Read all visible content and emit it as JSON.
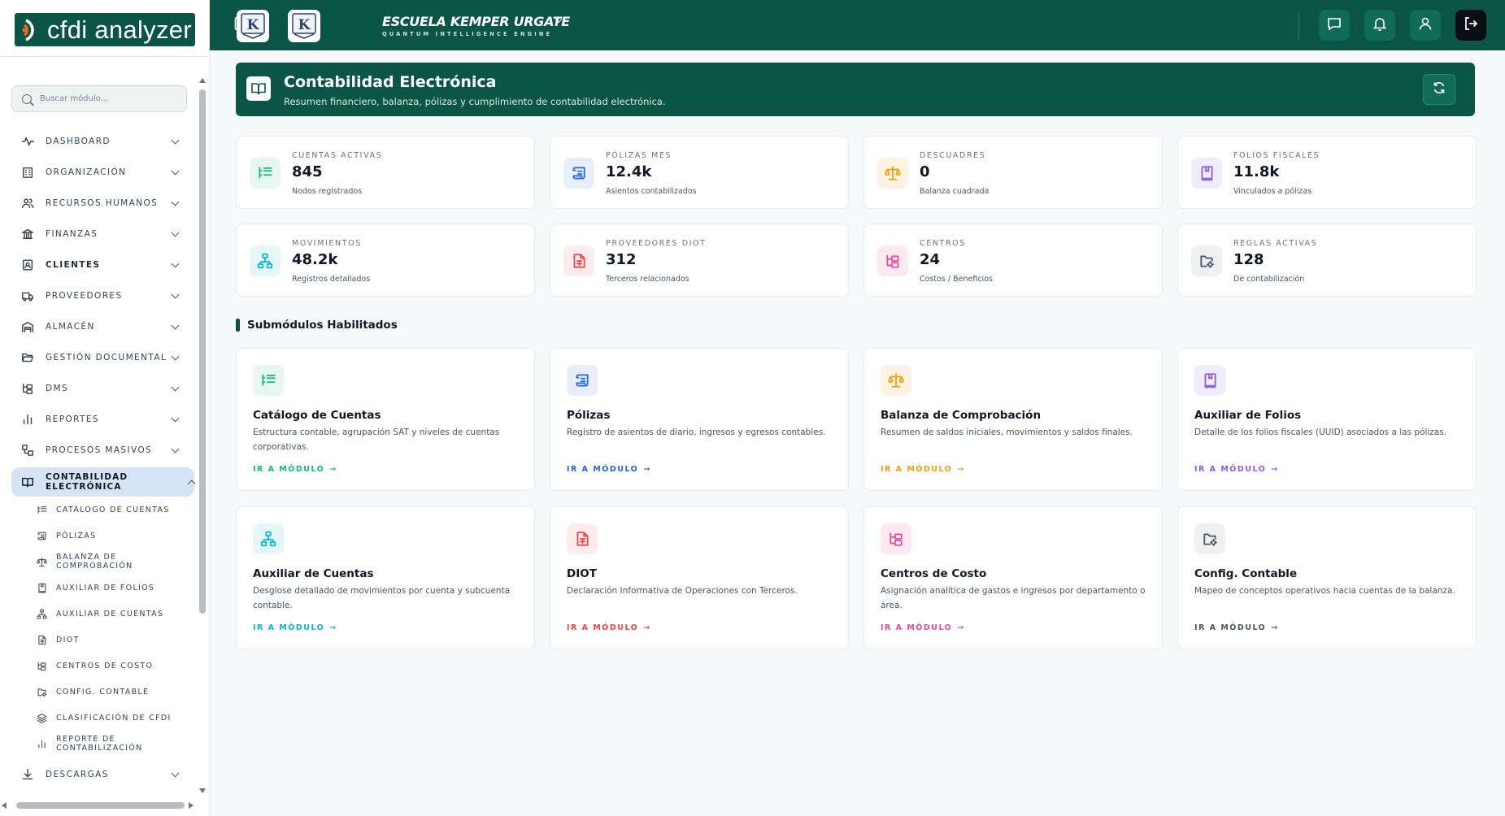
{
  "app": {
    "logo_text": "cfdi analyzer"
  },
  "search": {
    "placeholder": "Buscar módulo..."
  },
  "sidebar": {
    "items": [
      {
        "label": "DASHBOARD",
        "icon": "activity-icon"
      },
      {
        "label": "ORGANIZACIÓN",
        "icon": "building-icon"
      },
      {
        "label": "RECURSOS HUMANOS",
        "icon": "users-icon"
      },
      {
        "label": "FINANZAS",
        "icon": "bank-icon"
      },
      {
        "label": "CLIENTES",
        "icon": "contact-icon"
      },
      {
        "label": "PROVEEDORES",
        "icon": "truck-icon"
      },
      {
        "label": "ALMACÉN",
        "icon": "warehouse-icon"
      },
      {
        "label": "GESTIÓN DOCUMENTAL",
        "icon": "folder-open-icon"
      },
      {
        "label": "DMS",
        "icon": "folder-tree-icon"
      },
      {
        "label": "REPORTES",
        "icon": "bar-chart-icon"
      },
      {
        "label": "PROCESOS MASIVOS",
        "icon": "workflow-icon"
      },
      {
        "label": "CONTABILIDAD ELECTRÓNICA",
        "icon": "book-open-icon"
      }
    ],
    "subitems": [
      {
        "label": "CATÁLOGO DE CUENTAS",
        "icon": "list-tree-icon"
      },
      {
        "label": "PÓLIZAS",
        "icon": "scroll-icon"
      },
      {
        "label": "BALANZA DE COMPROBACIÓN",
        "icon": "scale-icon"
      },
      {
        "label": "AUXILIAR DE FOLIOS",
        "icon": "book-marked-icon"
      },
      {
        "label": "AUXILIAR DE CUENTAS",
        "icon": "network-icon"
      },
      {
        "label": "DIOT",
        "icon": "file-spreadsheet-icon"
      },
      {
        "label": "CENTROS DE COSTO",
        "icon": "folder-tree-icon"
      },
      {
        "label": "CONFIG. CONTABLE",
        "icon": "folder-cog-icon"
      },
      {
        "label": "CLASIFICACIÓN DE CFDI",
        "icon": "layers-icon"
      },
      {
        "label": "REPORTE DE CONTABILIZACIÓN",
        "icon": "bar-chart-icon"
      }
    ],
    "after": [
      {
        "label": "DESCARGAS",
        "icon": "download-icon"
      }
    ]
  },
  "topbar": {
    "company_name": "ESCUELA KEMPER URGATE",
    "company_tagline": "QUANTUM INTELLIGENCE ENGINE",
    "badge_letter": "K"
  },
  "hero": {
    "title": "Contabilidad Electrónica",
    "subtitle": "Resumen financiero, balanza, pólizas y cumplimiento de contabilidad electrónica."
  },
  "stats": [
    {
      "label": "CUENTAS ACTIVAS",
      "value": "845",
      "note": "Nodos registrados",
      "icon": "list-tree-icon",
      "color": "#10b981",
      "bg": "#e7f6f0"
    },
    {
      "label": "PÓLIZAS MES",
      "value": "12.4k",
      "note": "Asientos contabilizados",
      "icon": "scroll-icon",
      "color": "#2563eb",
      "bg": "#e8eefb"
    },
    {
      "label": "DESCUADRES",
      "value": "0",
      "note": "Balanza cuadrada",
      "icon": "scale-icon",
      "color": "#f59e0b",
      "bg": "#fdf3e2"
    },
    {
      "label": "FOLIOS FISCALES",
      "value": "11.8k",
      "note": "Vinculados a pólizas",
      "icon": "book-marked-icon",
      "color": "#8b5cf6",
      "bg": "#f1ecfd"
    },
    {
      "label": "MOVIMIENTOS",
      "value": "48.2k",
      "note": "Registros detallados",
      "icon": "network-icon",
      "color": "#06b6d4",
      "bg": "#e5f6f9"
    },
    {
      "label": "PROVEEDORES DIOT",
      "value": "312",
      "note": "Terceros relacionados",
      "icon": "file-spreadsheet-icon",
      "color": "#ef4444",
      "bg": "#fdecec"
    },
    {
      "label": "CENTROS",
      "value": "24",
      "note": "Costos / Beneficios",
      "icon": "folder-tree-icon",
      "color": "#ec4899",
      "bg": "#fce9f2"
    },
    {
      "label": "REGLAS ACTIVAS",
      "value": "128",
      "note": "De contabilización",
      "icon": "folder-cog-icon",
      "color": "#4b5563",
      "bg": "#eef0f2"
    }
  ],
  "section": {
    "title": "Submódulos Habilitados"
  },
  "modules": [
    {
      "title": "Catálogo de Cuentas",
      "desc": "Estructura contable, agrupación SAT y niveles de cuentas corporativas.",
      "link": "IR A MÓDULO",
      "icon": "list-tree-icon",
      "color": "#10b981",
      "bg": "#e7f6f0"
    },
    {
      "title": "Pólizas",
      "desc": "Registro de asientos de diario, ingresos y egresos contables.",
      "link": "IR A MÓDULO",
      "icon": "scroll-icon",
      "color": "#2563eb",
      "bg": "#e8eefb"
    },
    {
      "title": "Balanza de Comprobación",
      "desc": "Resumen de saldos iniciales, movimientos y saldos finales.",
      "link": "IR A MÓDULO",
      "icon": "scale-icon",
      "color": "#f59e0b",
      "bg": "#fdf3e2"
    },
    {
      "title": "Auxiliar de Folios",
      "desc": "Detalle de los folios fiscales (UUID) asociados a las pólizas.",
      "link": "IR A MÓDULO",
      "icon": "book-marked-icon",
      "color": "#8b5cf6",
      "bg": "#f1ecfd"
    },
    {
      "title": "Auxiliar de Cuentas",
      "desc": "Desglose detallado de movimientos por cuenta y subcuenta contable.",
      "link": "IR A MÓDULO",
      "icon": "network-icon",
      "color": "#06b6d4",
      "bg": "#e5f6f9"
    },
    {
      "title": "DIOT",
      "desc": "Declaración Informativa de Operaciones con Terceros.",
      "link": "IR A MÓDULO",
      "icon": "file-spreadsheet-icon",
      "color": "#ef4444",
      "bg": "#fdecec"
    },
    {
      "title": "Centros de Costo",
      "desc": "Asignación analítica de gastos e ingresos por departamento o área.",
      "link": "IR A MÓDULO",
      "icon": "folder-tree-icon",
      "color": "#ec4899",
      "bg": "#fce9f2"
    },
    {
      "title": "Config. Contable",
      "desc": "Mapeo de conceptos operativos hacia cuentas de la balanza.",
      "link": "IR A MÓDULO",
      "icon": "folder-cog-icon",
      "color": "#4b5563",
      "bg": "#eef0f2"
    }
  ],
  "colors": {
    "brand": "#0b5547",
    "brand_accent": "#f26a1b",
    "active_nav_bg": "#d7e3f6"
  }
}
